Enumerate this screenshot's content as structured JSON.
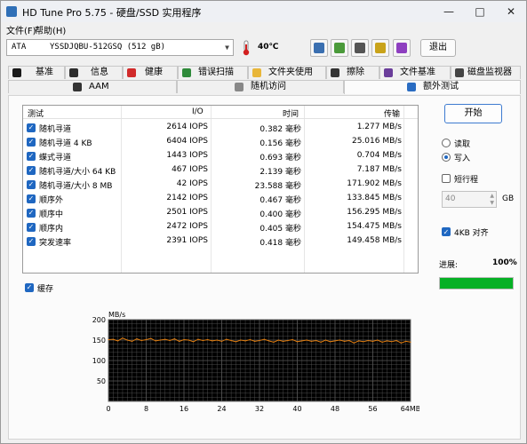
{
  "window": {
    "title": "HD Tune Pro 5.75 - 硬盘/SSD 实用程序"
  },
  "menu": {
    "file": "文件(F)",
    "help": "帮助(H)"
  },
  "toolbar": {
    "drive_bus": "ATA",
    "drive_name": "YSSDJQBU-512GSQ (512 gB)",
    "temperature": "40℃",
    "exit_label": "退出"
  },
  "tabs_row1": [
    {
      "label": "基准",
      "icon": "benchmark-icon"
    },
    {
      "label": "信息",
      "icon": "info-icon"
    },
    {
      "label": "健康",
      "icon": "health-icon"
    },
    {
      "label": "错误扫描",
      "icon": "error-scan-icon"
    },
    {
      "label": "文件夹使用",
      "icon": "folder-icon"
    },
    {
      "label": "擦除",
      "icon": "erase-icon"
    },
    {
      "label": "文件基准",
      "icon": "file-benchmark-icon"
    },
    {
      "label": "磁盘监视器",
      "icon": "disk-monitor-icon"
    }
  ],
  "tabs_row2": [
    {
      "label": "AAM",
      "icon": "speaker-icon"
    },
    {
      "label": "随机访问",
      "icon": "random-access-icon"
    },
    {
      "label": "额外测试",
      "icon": "extra-tests-icon"
    }
  ],
  "table": {
    "headers": [
      "测试",
      "I/O",
      "时间",
      "传输"
    ],
    "rows": [
      {
        "test": "随机寻道",
        "io": "2614 IOPS",
        "time": "0.382 毫秒",
        "transfer": "1.277 MB/s"
      },
      {
        "test": "随机寻道 4 KB",
        "io": "6404 IOPS",
        "time": "0.156 毫秒",
        "transfer": "25.016 MB/s"
      },
      {
        "test": "蝶式寻道",
        "io": "1443 IOPS",
        "time": "0.693 毫秒",
        "transfer": "0.704 MB/s"
      },
      {
        "test": "随机寻道/大小 64 KB",
        "io": "467 IOPS",
        "time": "2.139 毫秒",
        "transfer": "7.187 MB/s"
      },
      {
        "test": "随机寻道/大小 8 MB",
        "io": "42 IOPS",
        "time": "23.588 毫秒",
        "transfer": "171.902 MB/s"
      },
      {
        "test": "顺序外",
        "io": "2142 IOPS",
        "time": "0.467 毫秒",
        "transfer": "133.845 MB/s"
      },
      {
        "test": "顺序中",
        "io": "2501 IOPS",
        "time": "0.400 毫秒",
        "transfer": "156.295 MB/s"
      },
      {
        "test": "顺序内",
        "io": "2472 IOPS",
        "time": "0.405 毫秒",
        "transfer": "154.475 MB/s"
      },
      {
        "test": "突发速率",
        "io": "2391 IOPS",
        "time": "0.418 毫秒",
        "transfer": "149.458 MB/s"
      }
    ]
  },
  "cache_label": "缓存",
  "controls": {
    "start_label": "开始",
    "read_label": "读取",
    "write_label": "写入",
    "short_stroke_label": "短行程",
    "short_stroke_value": "40",
    "short_stroke_unit": "GB",
    "align_label": "4KB 对齐",
    "progress_label": "进展:",
    "progress_value": "100%",
    "progress_fraction": 1.0
  },
  "colors": {
    "accent": "#1f67c1",
    "progress": "#06b025",
    "chart_line": "#e07d10",
    "chart_bg": "#000000",
    "chart_grid": "#5a5a5a"
  },
  "chart_data": {
    "type": "line",
    "ylabel": "MB/s",
    "ylim": [
      0,
      200
    ],
    "yticks": [
      50,
      100,
      150,
      200
    ],
    "xlim": [
      0,
      64
    ],
    "xticks": [
      "0",
      "8",
      "16",
      "24",
      "32",
      "40",
      "48",
      "56",
      "64MB"
    ],
    "series": [
      {
        "x": [
          0,
          1,
          2,
          3,
          4,
          5,
          6,
          7,
          8,
          9,
          10,
          11,
          12,
          13,
          14,
          15,
          16,
          17,
          18,
          19,
          20,
          21,
          22,
          23,
          24,
          25,
          26,
          27,
          28,
          29,
          30,
          31,
          32,
          33,
          34,
          35,
          36,
          37,
          38,
          39,
          40,
          41,
          42,
          43,
          44,
          45,
          46,
          47,
          48,
          49,
          50,
          51,
          52,
          53,
          54,
          55,
          56,
          57,
          58,
          59,
          60,
          61,
          62,
          63,
          64
        ],
        "y": [
          151,
          152,
          148,
          155,
          150,
          147,
          153,
          149,
          151,
          154,
          148,
          150,
          152,
          149,
          153,
          147,
          151,
          150,
          146,
          152,
          149,
          151,
          148,
          150,
          147,
          152,
          149,
          146,
          150,
          148,
          151,
          147,
          149,
          152,
          148,
          145,
          150,
          147,
          149,
          151,
          146,
          148,
          150,
          147,
          149,
          145,
          150,
          146,
          148,
          150,
          147,
          149,
          143,
          148,
          146,
          149,
          147,
          150,
          145,
          148,
          146,
          149,
          143,
          147,
          145
        ]
      }
    ]
  }
}
